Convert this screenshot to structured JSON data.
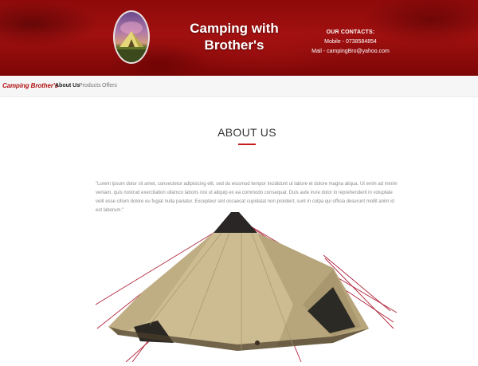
{
  "header": {
    "site_title": "Camping with Brother's",
    "contacts": {
      "heading": "OUR CONTACTS:",
      "mobile": "Mobile - 0738584854",
      "mail": "Mail - campingBro@yahoo.com"
    }
  },
  "navbar": {
    "brand": "Camping Brother's",
    "links": [
      {
        "label": "About Us",
        "active": true
      },
      {
        "label": "Products",
        "active": false
      },
      {
        "label": "Offers",
        "active": false
      }
    ]
  },
  "about": {
    "title": "ABOUT US",
    "text": "\"Lorem ipsum dolor sit amet, consectetur adipisicing elit, sed do eiusmod tempor incididunt ut labore et dolore magna aliqua. Ut enim ad minim veniam, quis nostrud exercitation ullamco laboris nisi ut aliquip ex ea commodo consequat. Duis aute irure dolor in reprehenderit in voluptate velit esse cillum dolore eu fugiat nulla pariatur. Excepteur sint occaecat cupidatat non proident, sunt in culpa qui officia deserunt mollit anim id est laborum.\""
  },
  "colors": {
    "banner_red": "#a11010",
    "brand_red": "#b11212",
    "accent_red": "#c81a1a",
    "tent_canvas": "#c9b58c"
  },
  "icons": {
    "logo": "tent-logo-icon",
    "hero": "bell-tent-image"
  }
}
